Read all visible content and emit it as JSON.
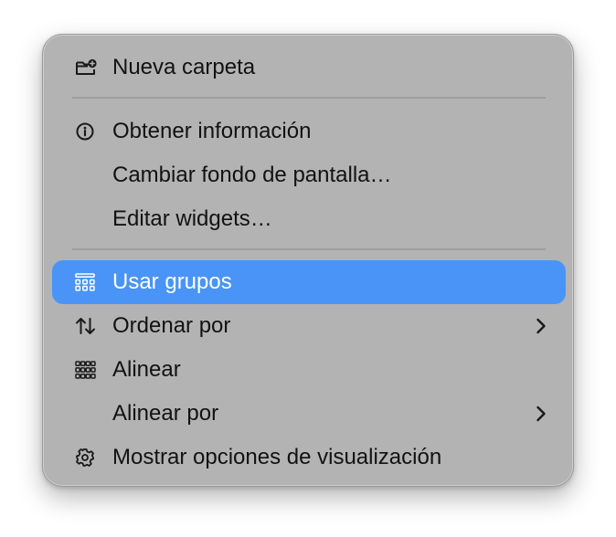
{
  "menu": {
    "items": [
      {
        "label": "Nueva carpeta",
        "icon": "new-folder-icon"
      },
      {
        "label": "Obtener información",
        "icon": "info-icon"
      },
      {
        "label": "Cambiar fondo de pantalla…",
        "icon": null
      },
      {
        "label": "Editar widgets…",
        "icon": null
      },
      {
        "label": "Usar grupos",
        "icon": "stacks-icon",
        "highlighted": true
      },
      {
        "label": "Ordenar por",
        "icon": "sort-arrows-icon",
        "submenu": true
      },
      {
        "label": "Alinear",
        "icon": "grid-icon"
      },
      {
        "label": "Alinear por",
        "icon": null,
        "submenu": true
      },
      {
        "label": "Mostrar opciones de visualización",
        "icon": "gear-icon"
      }
    ]
  },
  "colors": {
    "menu_background": "#b3b3b3",
    "highlight": "#4a94f7",
    "text": "#121212",
    "separator": "#9e9e9e"
  }
}
